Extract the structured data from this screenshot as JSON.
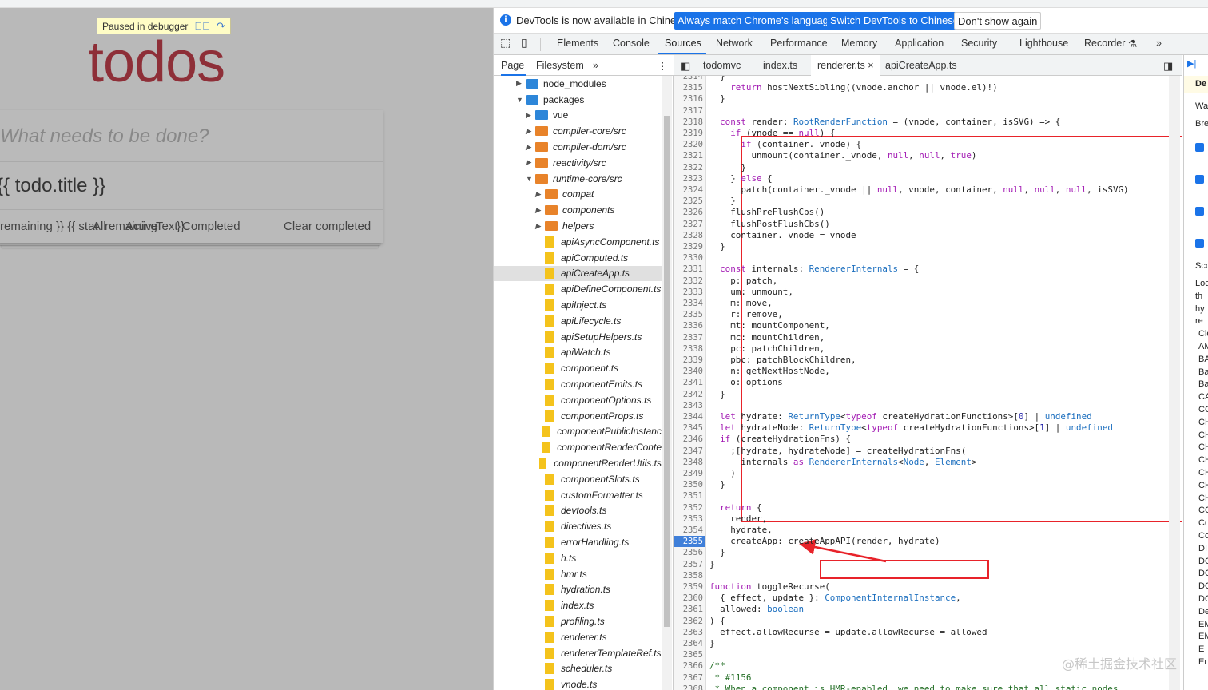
{
  "page": {
    "paused_label": "Paused in debugger",
    "title": "todos",
    "new_todo_placeholder": "What needs to be done?",
    "todo_item_text": "{{ todo.title }}",
    "footer_left": "remaining }} {{ stat",
    "footer_mid1": "All",
    "footer_mid2": "remaining",
    "footer_mid3": "Active",
    "footer_mid4": "Text",
    "footer_mid5": "}}",
    "footer_mid6": "Completed",
    "clear_completed": "Clear completed"
  },
  "infobar": {
    "message": "DevTools is now available in Chinese!",
    "match_language": "Always match Chrome's language",
    "switch_chinese": "Switch DevTools to Chinese",
    "dont_show": "Don't show again"
  },
  "tabs": [
    "Elements",
    "Console",
    "Sources",
    "Network",
    "Performance",
    "Memory",
    "Application",
    "Security",
    "Lighthouse",
    "Recorder"
  ],
  "active_tab": "Sources",
  "navigator": {
    "tab_page": "Page",
    "tab_filesystem": "Filesystem",
    "more": "»",
    "menu": "⋮",
    "tree": [
      {
        "label": "node_modules",
        "kind": "folder-blue",
        "expand": "▶",
        "indent": 0
      },
      {
        "label": "packages",
        "kind": "folder-blue",
        "expand": "▼",
        "indent": 0
      },
      {
        "label": "vue",
        "kind": "folder-blue",
        "expand": "▶",
        "indent": 1
      },
      {
        "label": "compiler-core/src",
        "kind": "folder-orange",
        "expand": "▶",
        "indent": 1
      },
      {
        "label": "compiler-dom/src",
        "kind": "folder-orange",
        "expand": "▶",
        "indent": 1
      },
      {
        "label": "reactivity/src",
        "kind": "folder-orange",
        "expand": "▶",
        "indent": 1
      },
      {
        "label": "runtime-core/src",
        "kind": "folder-orange",
        "expand": "▼",
        "indent": 1
      },
      {
        "label": "compat",
        "kind": "folder-orange",
        "expand": "▶",
        "indent": 2
      },
      {
        "label": "components",
        "kind": "folder-orange",
        "expand": "▶",
        "indent": 2
      },
      {
        "label": "helpers",
        "kind": "folder-orange",
        "expand": "▶",
        "indent": 2
      },
      {
        "label": "apiAsyncComponent.ts",
        "kind": "file",
        "indent": 2
      },
      {
        "label": "apiComputed.ts",
        "kind": "file",
        "indent": 2
      },
      {
        "label": "apiCreateApp.ts",
        "kind": "file",
        "indent": 2,
        "selected": true
      },
      {
        "label": "apiDefineComponent.ts",
        "kind": "file",
        "indent": 2
      },
      {
        "label": "apiInject.ts",
        "kind": "file",
        "indent": 2
      },
      {
        "label": "apiLifecycle.ts",
        "kind": "file",
        "indent": 2
      },
      {
        "label": "apiSetupHelpers.ts",
        "kind": "file",
        "indent": 2
      },
      {
        "label": "apiWatch.ts",
        "kind": "file",
        "indent": 2
      },
      {
        "label": "component.ts",
        "kind": "file",
        "indent": 2
      },
      {
        "label": "componentEmits.ts",
        "kind": "file",
        "indent": 2
      },
      {
        "label": "componentOptions.ts",
        "kind": "file",
        "indent": 2
      },
      {
        "label": "componentProps.ts",
        "kind": "file",
        "indent": 2
      },
      {
        "label": "componentPublicInstanc",
        "kind": "file",
        "indent": 2
      },
      {
        "label": "componentRenderConte",
        "kind": "file",
        "indent": 2
      },
      {
        "label": "componentRenderUtils.ts",
        "kind": "file",
        "indent": 2
      },
      {
        "label": "componentSlots.ts",
        "kind": "file",
        "indent": 2
      },
      {
        "label": "customFormatter.ts",
        "kind": "file",
        "indent": 2
      },
      {
        "label": "devtools.ts",
        "kind": "file",
        "indent": 2
      },
      {
        "label": "directives.ts",
        "kind": "file",
        "indent": 2
      },
      {
        "label": "errorHandling.ts",
        "kind": "file",
        "indent": 2
      },
      {
        "label": "h.ts",
        "kind": "file",
        "indent": 2
      },
      {
        "label": "hmr.ts",
        "kind": "file",
        "indent": 2
      },
      {
        "label": "hydration.ts",
        "kind": "file",
        "indent": 2
      },
      {
        "label": "index.ts",
        "kind": "file",
        "indent": 2
      },
      {
        "label": "profiling.ts",
        "kind": "file",
        "indent": 2
      },
      {
        "label": "renderer.ts",
        "kind": "file",
        "indent": 2
      },
      {
        "label": "rendererTemplateRef.ts",
        "kind": "file",
        "indent": 2
      },
      {
        "label": "scheduler.ts",
        "kind": "file",
        "indent": 2
      },
      {
        "label": "vnode.ts",
        "kind": "file",
        "indent": 2
      }
    ]
  },
  "editor": {
    "tabs": [
      "todomvc",
      "index.ts",
      "renderer.ts",
      "apiCreateApp.ts"
    ],
    "active_tab": "renderer.ts",
    "close_glyph": "×",
    "breakpoint_line": "2355",
    "lines": [
      {
        "n": "2314",
        "html": "  }"
      },
      {
        "n": "2315",
        "html": "    <span class=\"kw\">return</span> hostNextSibling((vnode.anchor || vnode.el)!)"
      },
      {
        "n": "2316",
        "html": "  }"
      },
      {
        "n": "2317",
        "html": ""
      },
      {
        "n": "2318",
        "html": "  <span class=\"kw\">const</span> render: <span class=\"ty\">RootRenderFunction</span> = (vnode, container, isSVG) => {"
      },
      {
        "n": "2319",
        "html": "    <span class=\"kw\">if</span> (vnode == <span class=\"kw\">null</span>) {"
      },
      {
        "n": "2320",
        "html": "      <span class=\"kw\">if</span> (container._vnode) {"
      },
      {
        "n": "2321",
        "html": "        unmount(container._vnode, <span class=\"kw\">null</span>, <span class=\"kw\">null</span>, <span class=\"kw\">true</span>)"
      },
      {
        "n": "2322",
        "html": "      }"
      },
      {
        "n": "2323",
        "html": "    } <span class=\"kw\">else</span> {"
      },
      {
        "n": "2324",
        "html": "      patch(container._vnode || <span class=\"kw\">null</span>, vnode, container, <span class=\"kw\">null</span>, <span class=\"kw\">null</span>, <span class=\"kw\">null</span>, isSVG)"
      },
      {
        "n": "2325",
        "html": "    }"
      },
      {
        "n": "2326",
        "html": "    flushPreFlushCbs()"
      },
      {
        "n": "2327",
        "html": "    flushPostFlushCbs()"
      },
      {
        "n": "2328",
        "html": "    container._vnode = vnode"
      },
      {
        "n": "2329",
        "html": "  }"
      },
      {
        "n": "2330",
        "html": ""
      },
      {
        "n": "2331",
        "html": "  <span class=\"kw\">const</span> internals: <span class=\"ty\">RendererInternals</span> = {"
      },
      {
        "n": "2332",
        "html": "    p: patch,"
      },
      {
        "n": "2333",
        "html": "    um: unmount,"
      },
      {
        "n": "2334",
        "html": "    m: move,"
      },
      {
        "n": "2335",
        "html": "    r: remove,"
      },
      {
        "n": "2336",
        "html": "    mt: mountComponent,"
      },
      {
        "n": "2337",
        "html": "    mc: mountChildren,"
      },
      {
        "n": "2338",
        "html": "    pc: patchChildren,"
      },
      {
        "n": "2339",
        "html": "    pbc: patchBlockChildren,"
      },
      {
        "n": "2340",
        "html": "    n: getNextHostNode,"
      },
      {
        "n": "2341",
        "html": "    o: options"
      },
      {
        "n": "2342",
        "html": "  }"
      },
      {
        "n": "2343",
        "html": ""
      },
      {
        "n": "2344",
        "html": "  <span class=\"kw\">let</span> hydrate: <span class=\"ty\">ReturnType</span>&lt;<span class=\"kw\">typeof</span> createHydrationFunctions&gt;[<span class=\"nu\">0</span>] | <span class=\"ty\">undefined</span>"
      },
      {
        "n": "2345",
        "html": "  <span class=\"kw\">let</span> hydrateNode: <span class=\"ty\">ReturnType</span>&lt;<span class=\"kw\">typeof</span> createHydrationFunctions&gt;[<span class=\"nu\">1</span>] | <span class=\"ty\">undefined</span>"
      },
      {
        "n": "2346",
        "html": "  <span class=\"kw\">if</span> (createHydrationFns) {"
      },
      {
        "n": "2347",
        "html": "    ;[hydrate, hydrateNode] = createHydrationFns("
      },
      {
        "n": "2348",
        "html": "      internals <span class=\"kw\">as</span> <span class=\"ty\">RendererInternals</span>&lt;<span class=\"ty\">Node</span>, <span class=\"ty\">Element</span>&gt;"
      },
      {
        "n": "2349",
        "html": "    )"
      },
      {
        "n": "2350",
        "html": "  }"
      },
      {
        "n": "2351",
        "html": ""
      },
      {
        "n": "2352",
        "html": "  <span class=\"kw\">return</span> {"
      },
      {
        "n": "2353",
        "html": "    render,"
      },
      {
        "n": "2354",
        "html": "    hydrate,"
      },
      {
        "n": "2355",
        "html": "    createApp: createAppAPI(render, hydrate)"
      },
      {
        "n": "2356",
        "html": "  }"
      },
      {
        "n": "2357",
        "html": "}"
      },
      {
        "n": "2358",
        "html": ""
      },
      {
        "n": "2359",
        "html": "<span class=\"kw\">function</span> toggleRecurse("
      },
      {
        "n": "2360",
        "html": "  { effect, update }: <span class=\"ty\">ComponentInternalInstance</span>,"
      },
      {
        "n": "2361",
        "html": "  allowed: <span class=\"ty\">boolean</span>"
      },
      {
        "n": "2362",
        "html": ") {"
      },
      {
        "n": "2363",
        "html": "  effect.allowRecurse = update.allowRecurse = allowed"
      },
      {
        "n": "2364",
        "html": "}"
      },
      {
        "n": "2365",
        "html": ""
      },
      {
        "n": "2366",
        "html": "<span class=\"cm\">/**</span>"
      },
      {
        "n": "2367",
        "html": "<span class=\"cm\"> * #1156</span>"
      },
      {
        "n": "2368",
        "html": "<span class=\"cm\"> * When a component is HMR-enabled, we need to make sure that all static nodes</span>"
      }
    ]
  },
  "right_panel": {
    "labels": [
      "De",
      "Wa",
      "Bre",
      "Sco",
      "Loc",
      "th",
      "hy",
      "re",
      "Clo",
      "AM",
      "BA",
      "Ba",
      "Ba",
      "CA",
      "CC",
      "CH",
      "CH",
      "CH",
      "CH",
      "CH",
      "CH",
      "CH",
      "CO",
      "Co",
      "Co",
      "DI",
      "DO",
      "DO",
      "DO",
      "DO",
      "De",
      "EM",
      "EM",
      "E",
      "Er"
    ]
  },
  "watermark": "@稀土掘金技术社区"
}
